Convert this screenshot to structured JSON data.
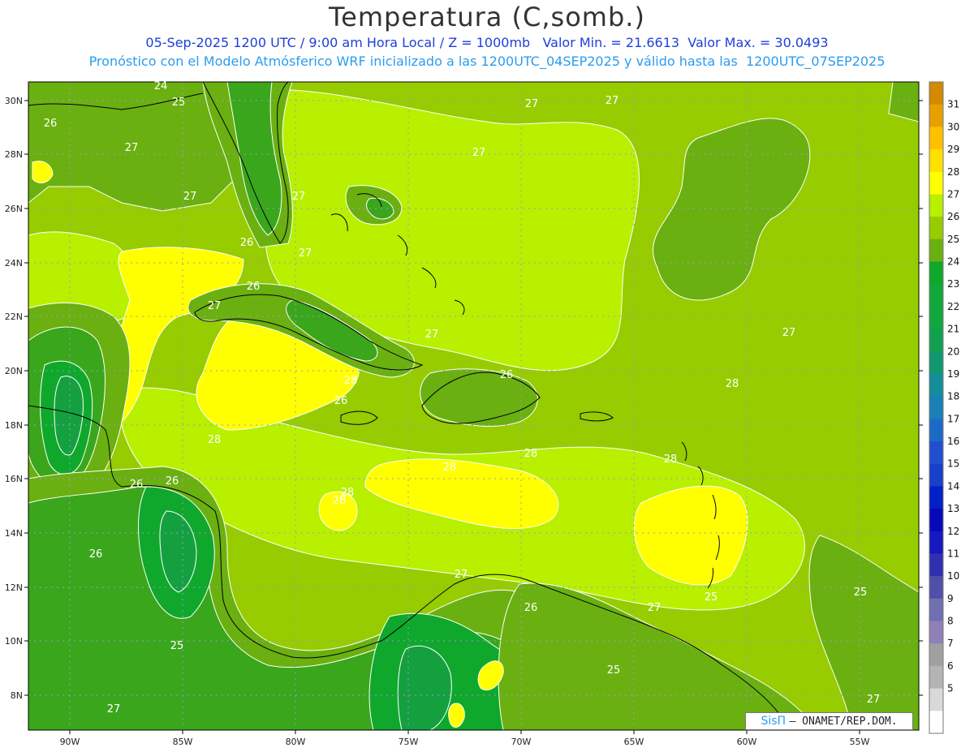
{
  "header": {
    "title": "Temperatura (C,somb.)",
    "line1": "05-Sep-2025 1200 UTC / 9:00 am Hora Local / Z = 1000mb   Valor Min. = 21.6613  Valor Max. = 30.0493",
    "line2": "Pronóstico con el Modelo Atmósferico WRF inicializado a las 1200UTC_04SEP2025 y válido hasta las  1200UTC_07SEP2025"
  },
  "axes": {
    "lat_labels": [
      "30N",
      "28N",
      "26N",
      "24N",
      "22N",
      "20N",
      "18N",
      "16N",
      "14N",
      "12N",
      "10N",
      "8N"
    ],
    "lon_labels": [
      "90W",
      "85W",
      "80W",
      "75W",
      "70W",
      "65W",
      "60W",
      "55W"
    ]
  },
  "contour_labels": [
    "24",
    "25",
    "26",
    "27",
    "27",
    "27",
    "27",
    "27",
    "26",
    "27",
    "27",
    "26",
    "27",
    "27",
    "26",
    "28",
    "26",
    "27",
    "28",
    "28",
    "28",
    "28",
    "28",
    "28",
    "25",
    "26",
    "26",
    "26",
    "27",
    "26",
    "27",
    "25",
    "25",
    "27",
    "27",
    "25",
    "28"
  ],
  "colorbar": {
    "labels": [
      "31",
      "30",
      "29",
      "28",
      "27",
      "26",
      "25",
      "24",
      "23",
      "22",
      "21",
      "20",
      "19",
      "18",
      "17",
      "16",
      "15",
      "14",
      "13",
      "12",
      "11",
      "10",
      "9",
      "8",
      "7",
      "6",
      "5"
    ],
    "colors": [
      "#ffffff",
      "#d9d9d9",
      "#b4b4b4",
      "#a0a0a0",
      "#9080b8",
      "#7070b0",
      "#5050a8",
      "#3030b0",
      "#1818c0",
      "#0808b8",
      "#0020c8",
      "#1840c8",
      "#2050d0",
      "#1c6ac8",
      "#1a80b8",
      "#138c9c",
      "#109870",
      "#10a050",
      "#12a840",
      "#10a838",
      "#0fa82c",
      "#6ab010",
      "#96cc00",
      "#b8f000",
      "#ffff00",
      "#ffe000",
      "#ffc000",
      "#e8a000",
      "#d28a00"
    ]
  },
  "credit": {
    "logo": "SisΠ",
    "text": "– ONAMET/REP.DOM."
  },
  "colors": {
    "t24": "#0fa82c",
    "t25": "#3aa61c",
    "t26": "#6ab010",
    "t27": "#96cc00",
    "t28": "#b8f000",
    "t29": "#ffff00",
    "grid": "#9a9ad0"
  }
}
